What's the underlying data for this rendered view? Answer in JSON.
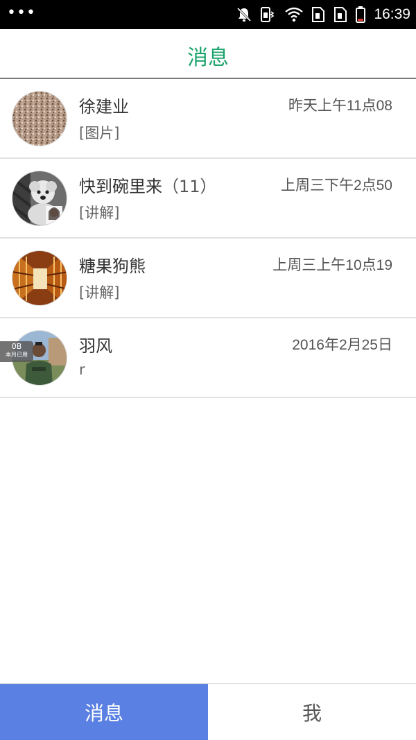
{
  "status_bar": {
    "time": "16:39",
    "icons": [
      "overflow-dots-icon",
      "notifications-muted-icon",
      "sim-vibrate-icon",
      "wifi-icon",
      "sim1-icon",
      "sim2-icon",
      "battery-icon"
    ]
  },
  "header": {
    "title": "消息"
  },
  "conversations": [
    {
      "name": "徐建业",
      "count": "",
      "time": "昨天上午11点08",
      "preview": "[图片]",
      "avatar": "gravel-texture-avatar"
    },
    {
      "name": "快到碗里来",
      "count": "（11）",
      "time": "上周三下午2点50",
      "preview": "[讲解]",
      "avatar": "group-dog-avatar"
    },
    {
      "name": "糖果狗熊",
      "count": "",
      "time": "上周三上午10点19",
      "preview": "[讲解]",
      "avatar": "corridor-photo-avatar"
    },
    {
      "name": "羽风",
      "count": "",
      "time": "2016年2月25日",
      "preview": "r",
      "avatar": "man-photo-avatar"
    }
  ],
  "data_badge": {
    "amount": "0B",
    "label": "本月已用"
  },
  "bottom_nav": {
    "tabs": [
      {
        "label": "消息",
        "active": true
      },
      {
        "label": "我",
        "active": false
      }
    ]
  },
  "colors": {
    "accent_green": "#1aa36a",
    "active_tab_blue": "#5a80e3",
    "status_bar": "#000000"
  }
}
